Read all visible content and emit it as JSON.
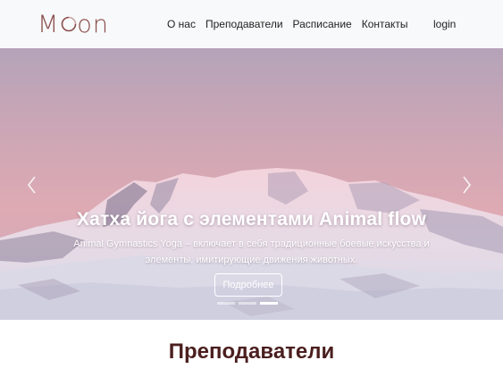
{
  "brand": {
    "logo_text_left": "M",
    "logo_text_right": "on",
    "color": "#8a4b4b"
  },
  "nav": {
    "items": [
      {
        "label": "О нас"
      },
      {
        "label": "Преподаватели"
      },
      {
        "label": "Расписание"
      },
      {
        "label": "Контакты"
      }
    ],
    "login_label": "login"
  },
  "carousel": {
    "slide": {
      "title": "Хатха йога с элементами Animal flow",
      "text": "Animal Gymnastics Yoga – включает в себя традиционные боевые искусства и элементы, имитирующие движения животных.",
      "button_label": "Подробнее"
    },
    "indicators": {
      "count": 3,
      "active_index": 2
    },
    "prev_icon": "chevron-left-icon",
    "next_icon": "chevron-right-icon"
  },
  "teachers_section": {
    "heading": "Преподаватели",
    "heading_color": "#4b1f1f"
  }
}
